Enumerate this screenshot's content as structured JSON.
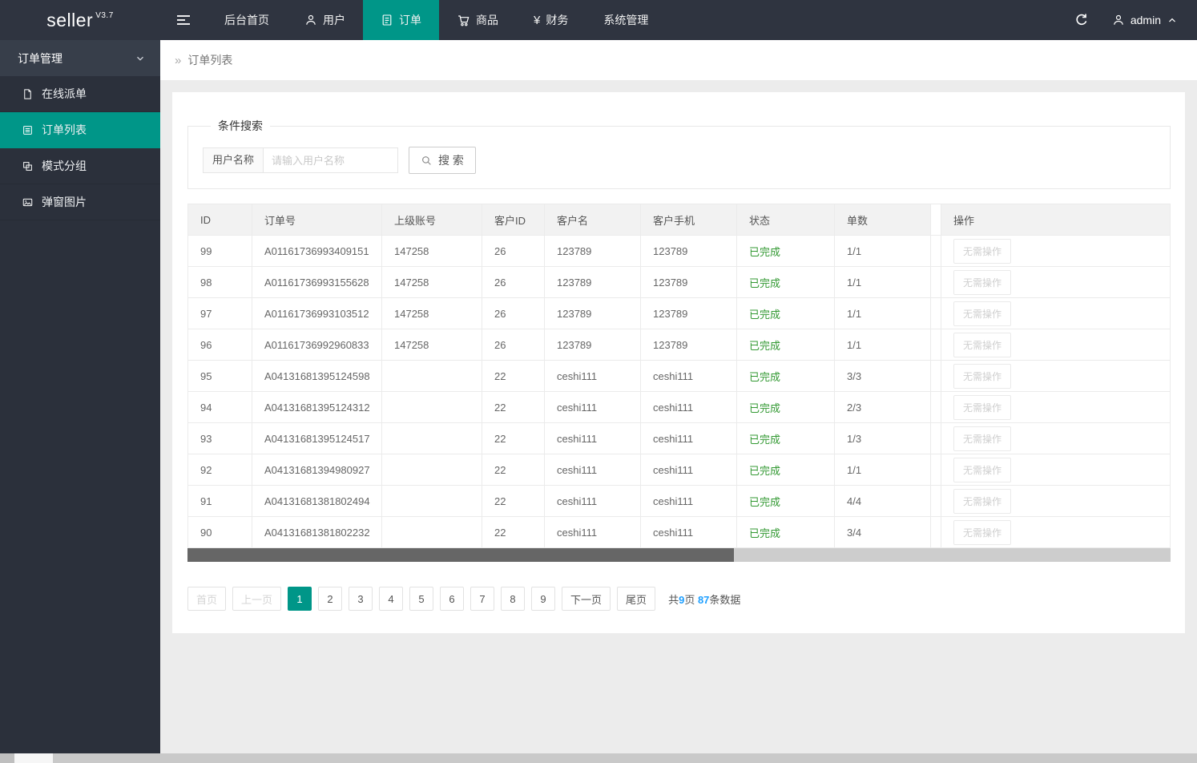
{
  "app": {
    "logo": "seller",
    "version": "V3.7"
  },
  "navbar": {
    "items": [
      {
        "label": "后台首页"
      },
      {
        "label": "用户"
      },
      {
        "label": "订单",
        "active": true
      },
      {
        "label": "商品"
      },
      {
        "label": "财务"
      },
      {
        "label": "系统管理"
      }
    ],
    "yen_glyph": "¥",
    "user": "admin"
  },
  "sidebar": {
    "group_label": "订单管理",
    "items": [
      {
        "label": "在线派单"
      },
      {
        "label": "订单列表",
        "active": true
      },
      {
        "label": "模式分组"
      },
      {
        "label": "弹窗图片"
      }
    ]
  },
  "breadcrumb": {
    "arrow": "»",
    "label": "订单列表"
  },
  "search": {
    "legend": "条件搜索",
    "field_label": "用户名称",
    "placeholder": "请输入用户名称",
    "button_label": "搜 索"
  },
  "table": {
    "headers": [
      "ID",
      "订单号",
      "上级账号",
      "客户ID",
      "客户名",
      "客户手机",
      "状态",
      "单数",
      "操作"
    ],
    "action_label": "无需操作",
    "rows": [
      {
        "id": "99",
        "order_no": "A01161736993409151",
        "parent_account": "147258",
        "customer_id": "26",
        "customer_name": "123789",
        "customer_phone": "123789",
        "status": "已完成",
        "count": "1/1",
        "action": "无需操作"
      },
      {
        "id": "98",
        "order_no": "A01161736993155628",
        "parent_account": "147258",
        "customer_id": "26",
        "customer_name": "123789",
        "customer_phone": "123789",
        "status": "已完成",
        "count": "1/1",
        "action": "无需操作"
      },
      {
        "id": "97",
        "order_no": "A01161736993103512",
        "parent_account": "147258",
        "customer_id": "26",
        "customer_name": "123789",
        "customer_phone": "123789",
        "status": "已完成",
        "count": "1/1",
        "action": "无需操作"
      },
      {
        "id": "96",
        "order_no": "A01161736992960833",
        "parent_account": "147258",
        "customer_id": "26",
        "customer_name": "123789",
        "customer_phone": "123789",
        "status": "已完成",
        "count": "1/1",
        "action": "无需操作"
      },
      {
        "id": "95",
        "order_no": "A04131681395124598",
        "parent_account": "",
        "customer_id": "22",
        "customer_name": "ceshi111",
        "customer_phone": "ceshi111",
        "status": "已完成",
        "count": "3/3",
        "action": "无需操作"
      },
      {
        "id": "94",
        "order_no": "A04131681395124312",
        "parent_account": "",
        "customer_id": "22",
        "customer_name": "ceshi111",
        "customer_phone": "ceshi111",
        "status": "已完成",
        "count": "2/3",
        "action": "无需操作"
      },
      {
        "id": "93",
        "order_no": "A04131681395124517",
        "parent_account": "",
        "customer_id": "22",
        "customer_name": "ceshi111",
        "customer_phone": "ceshi111",
        "status": "已完成",
        "count": "1/3",
        "action": "无需操作"
      },
      {
        "id": "92",
        "order_no": "A04131681394980927",
        "parent_account": "",
        "customer_id": "22",
        "customer_name": "ceshi111",
        "customer_phone": "ceshi111",
        "status": "已完成",
        "count": "1/1",
        "action": "无需操作"
      },
      {
        "id": "91",
        "order_no": "A04131681381802494",
        "parent_account": "",
        "customer_id": "22",
        "customer_name": "ceshi111",
        "customer_phone": "ceshi111",
        "status": "已完成",
        "count": "4/4",
        "action": "无需操作"
      },
      {
        "id": "90",
        "order_no": "A04131681381802232",
        "parent_account": "",
        "customer_id": "22",
        "customer_name": "ceshi111",
        "customer_phone": "ceshi111",
        "status": "已完成",
        "count": "3/4",
        "action": "无需操作"
      }
    ]
  },
  "pagination": {
    "first": "首页",
    "prev": "上一页",
    "pages": [
      {
        "label": "1",
        "active": true
      },
      {
        "label": "2"
      },
      {
        "label": "3"
      },
      {
        "label": "4"
      },
      {
        "label": "5"
      },
      {
        "label": "6"
      },
      {
        "label": "7"
      },
      {
        "label": "8"
      },
      {
        "label": "9"
      }
    ],
    "next": "下一页",
    "last": "尾页",
    "summary": {
      "seg1": "共",
      "total_pages": "9",
      "seg2": "页 ",
      "total_records": "87",
      "seg3": "条数据"
    }
  },
  "colors": {
    "accent_teal": "#009688",
    "status_green": "#339933",
    "link_blue": "#1E9FFF",
    "navbar_dark": "#2f3440"
  }
}
